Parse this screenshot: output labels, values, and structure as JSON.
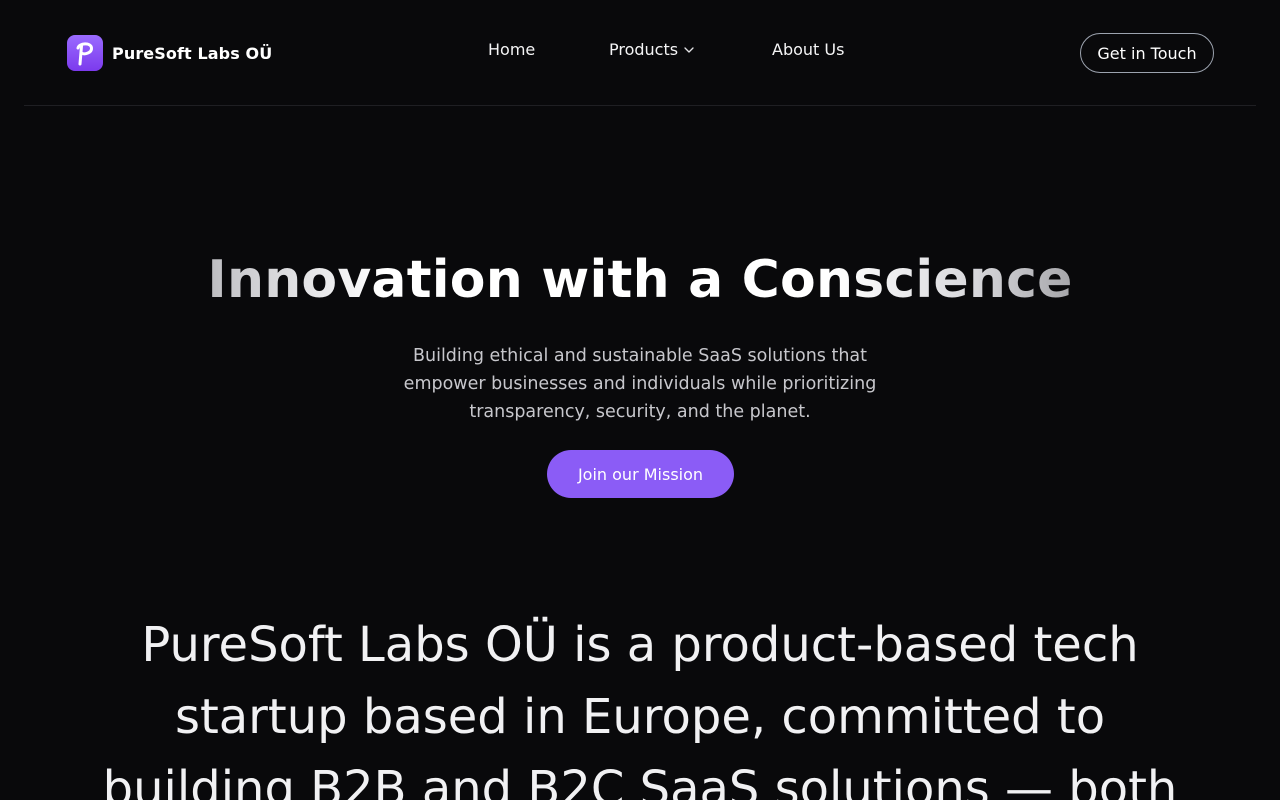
{
  "header": {
    "brand_name": "PureSoft Labs OÜ",
    "logo_icon": "p-letter-logo",
    "nav": {
      "home": "Home",
      "products": "Products",
      "about": "About Us"
    },
    "cta_label": "Get in Touch"
  },
  "hero": {
    "title": "Innovation with a Conscience",
    "subtitle": "Building ethical and sustainable SaaS solutions that empower businesses and individuals while prioritizing transparency, security, and the planet.",
    "cta_label": "Join our Mission"
  },
  "statement": {
    "text": "PureSoft Labs OÜ is a product-based tech startup based in Europe, committed to building B2B and B2C SaaS solutions — both"
  },
  "colors": {
    "background": "#09090b",
    "accent": "#8b5cf6",
    "logo_gradient_top": "#9a6bff",
    "logo_gradient_bottom": "#7c3aed"
  }
}
